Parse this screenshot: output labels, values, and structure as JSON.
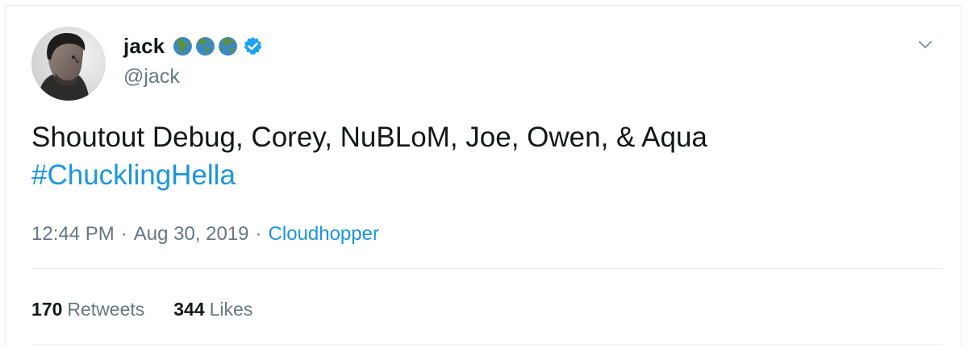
{
  "tweet": {
    "display_name": "jack",
    "handle": "@jack",
    "name_emojis": [
      "globe-africa-icon",
      "globe-americas-icon",
      "globe-asia-icon"
    ],
    "verified_icon": "verified-badge-icon",
    "text_main": "Shoutout Debug, Corey, NuBLoM, Joe, Owen, & Aqua",
    "hashtag": "#ChucklingHella",
    "time": "12:44 PM",
    "date": "Aug 30, 2019",
    "separator": "·",
    "source": "Cloudhopper",
    "retweets_count": "170",
    "retweets_label": "Retweets",
    "likes_count": "344",
    "likes_label": "Likes"
  },
  "colors": {
    "link": "#1b95e0",
    "text": "#14171a",
    "secondary": "#657786",
    "border": "#e6ecf0",
    "verified": "#1da1f2"
  },
  "icons": {
    "menu": "chevron-down-icon"
  }
}
